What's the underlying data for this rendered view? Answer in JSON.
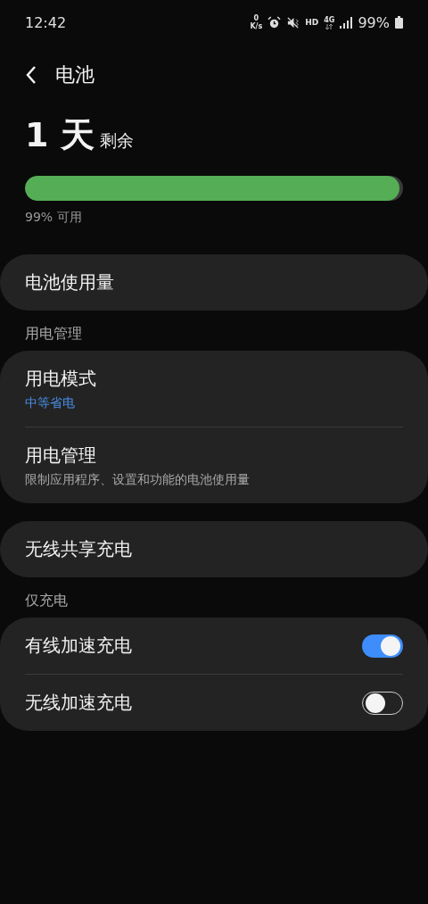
{
  "status_bar": {
    "time": "12:42",
    "net_value": "0",
    "net_unit": "K/s",
    "hd": "HD",
    "network": "4G",
    "battery": "99%"
  },
  "header": {
    "title": "电池"
  },
  "summary": {
    "value": "1 天",
    "suffix": "剩余",
    "level": 0.99,
    "available": "99% 可用"
  },
  "sections": [
    {
      "kind": "card",
      "rows": [
        {
          "kind": "nav",
          "title": "电池使用量"
        }
      ]
    },
    {
      "kind": "header",
      "title": "用电管理"
    },
    {
      "kind": "card",
      "rows": [
        {
          "kind": "nav",
          "title": "用电模式",
          "subtitle": "中等省电",
          "accent": true
        },
        {
          "kind": "nav",
          "title": "用电管理",
          "subtitle": "限制应用程序、设置和功能的电池使用量",
          "accent": false
        }
      ]
    },
    {
      "kind": "card",
      "rows": [
        {
          "kind": "nav",
          "title": "无线共享充电"
        }
      ]
    },
    {
      "kind": "header",
      "title": "仅充电"
    },
    {
      "kind": "card",
      "rows": [
        {
          "kind": "toggle",
          "title": "有线加速充电",
          "on": true
        },
        {
          "kind": "toggle",
          "title": "无线加速充电",
          "on": false
        }
      ]
    }
  ]
}
